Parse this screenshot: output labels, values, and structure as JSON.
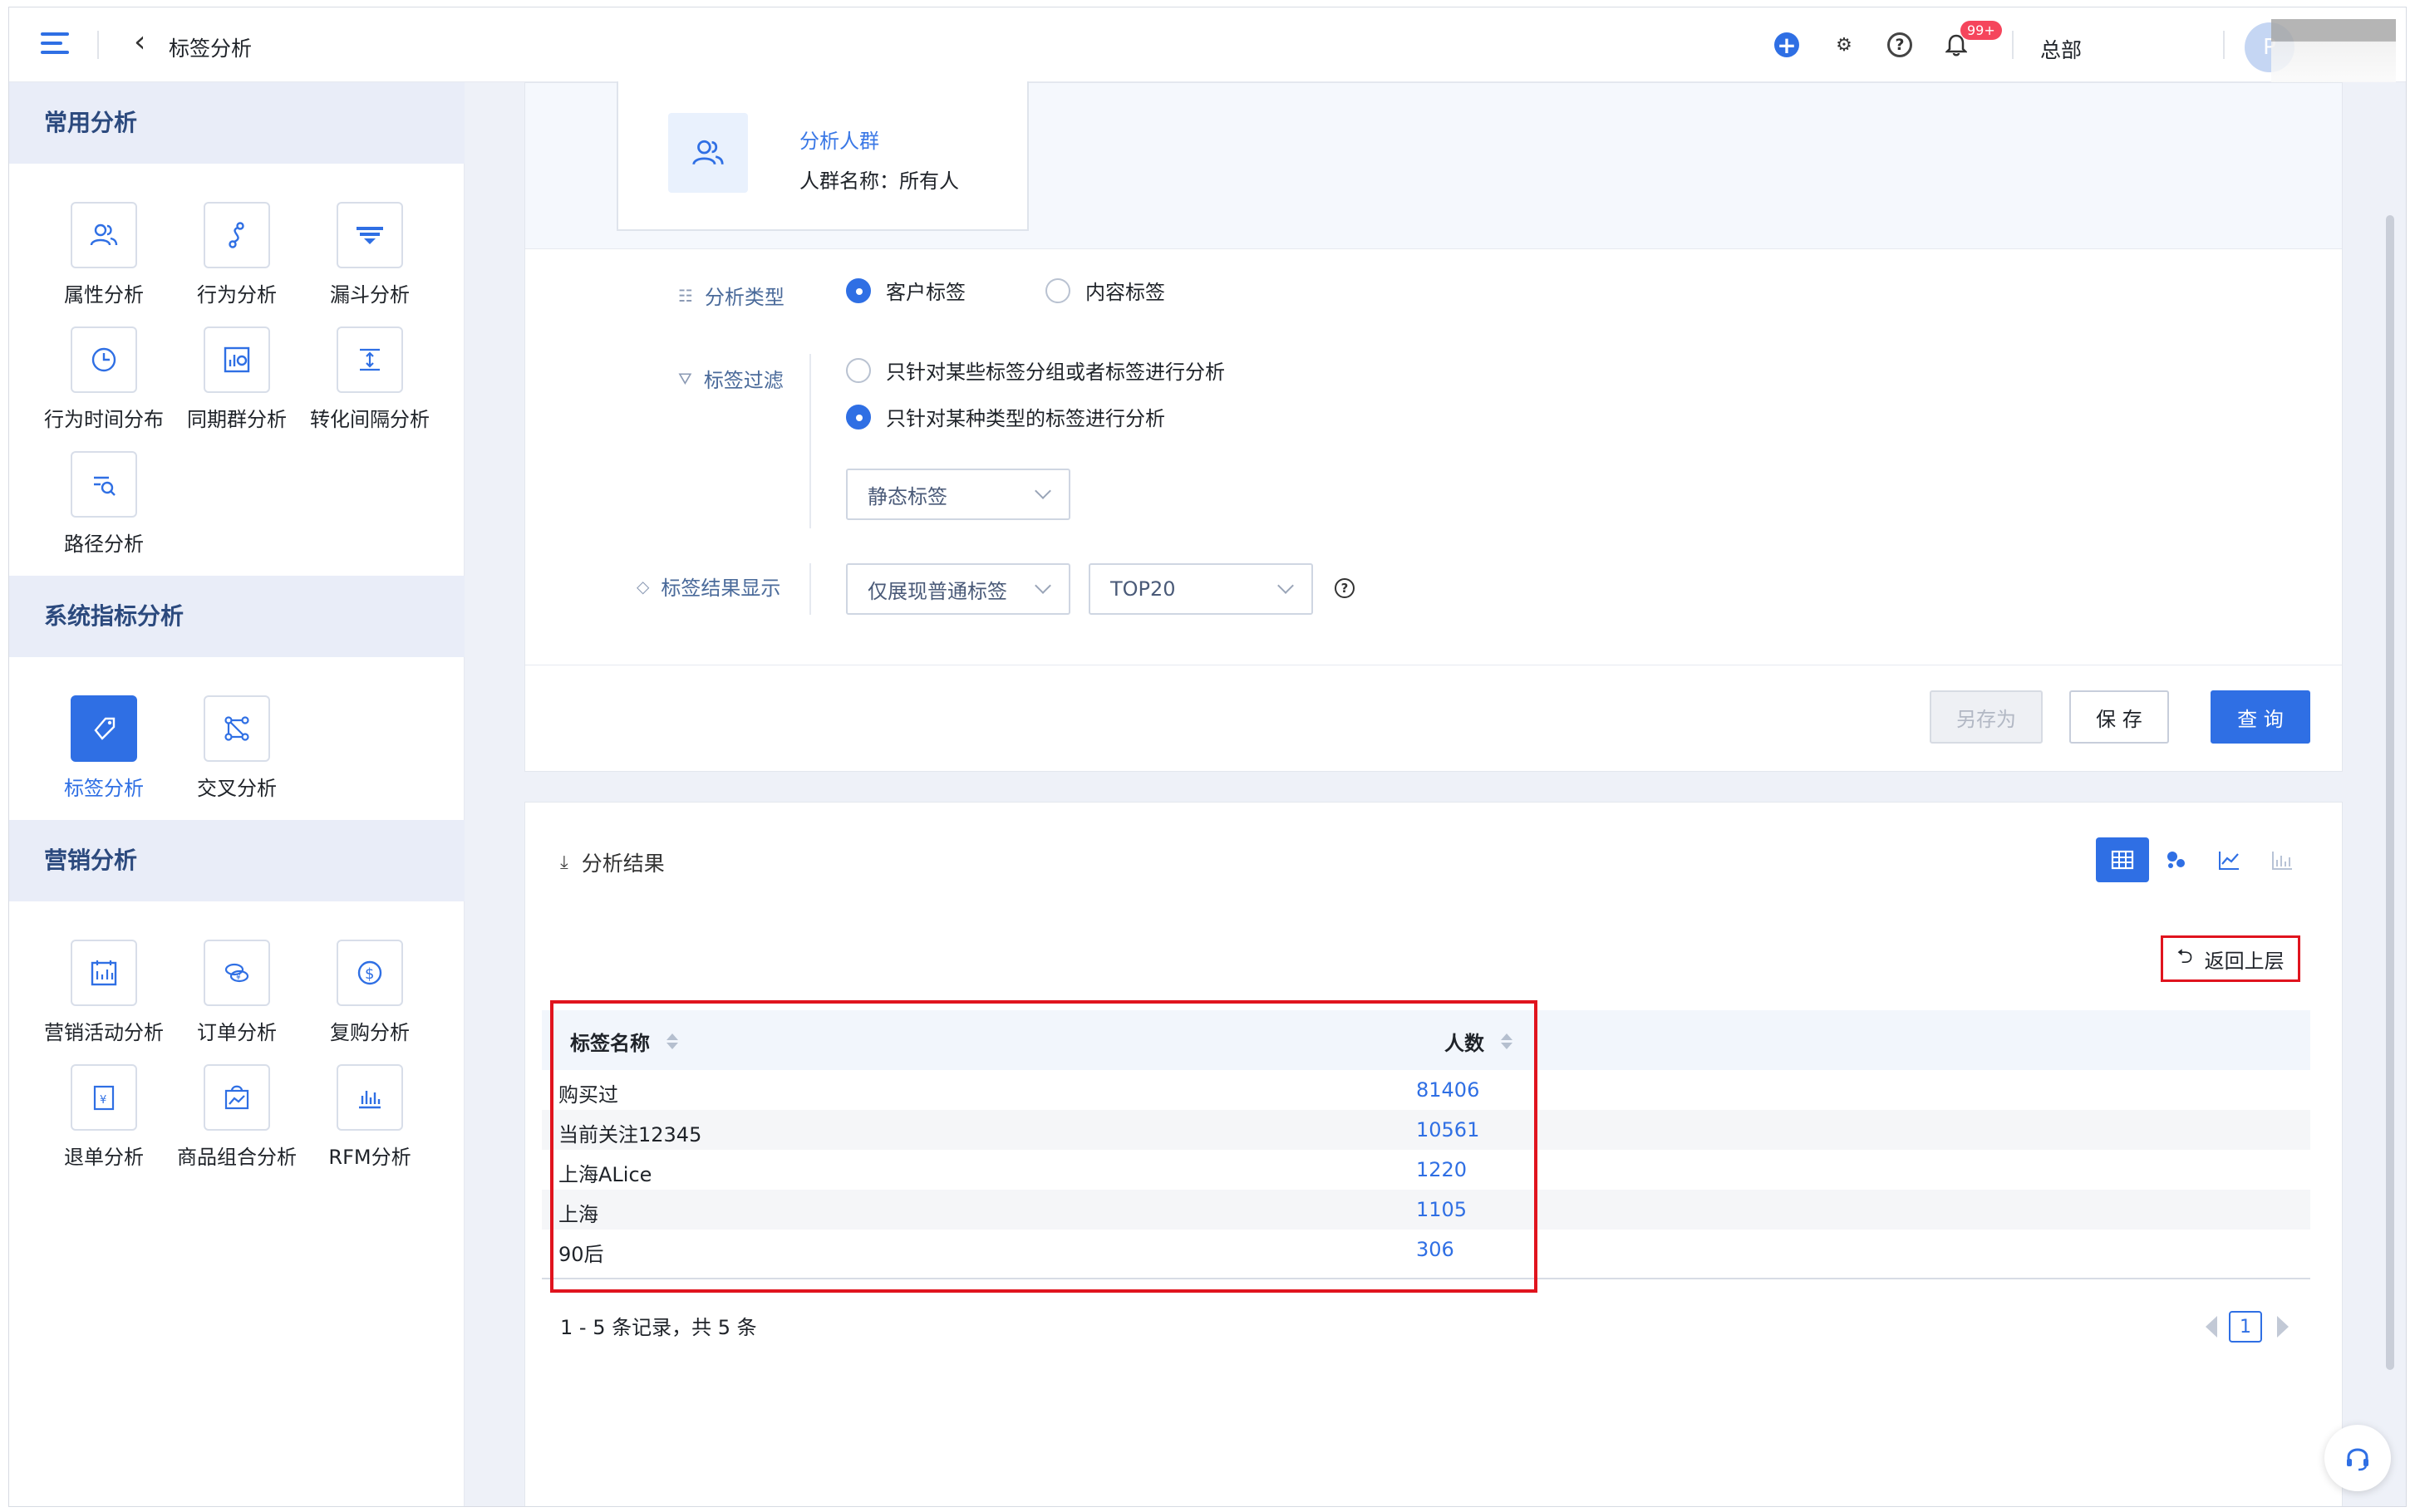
{
  "header": {
    "title": "标签分析",
    "org": "总部",
    "notification_badge": "99+",
    "avatar_initial": "P"
  },
  "sidebar": {
    "sections": [
      {
        "title": "常用分析",
        "items": [
          {
            "label": "属性分析",
            "icon": "users-icon"
          },
          {
            "label": "行为分析",
            "icon": "path-icon"
          },
          {
            "label": "漏斗分析",
            "icon": "funnel-icon"
          },
          {
            "label": "行为时间分布",
            "icon": "clock-icon"
          },
          {
            "label": "同期群分析",
            "icon": "cohort-icon"
          },
          {
            "label": "转化间隔分析",
            "icon": "interval-icon"
          },
          {
            "label": "路径分析",
            "icon": "route-icon"
          }
        ]
      },
      {
        "title": "系统指标分析",
        "items": [
          {
            "label": "标签分析",
            "icon": "tag-icon",
            "active": true
          },
          {
            "label": "交叉分析",
            "icon": "cross-icon"
          }
        ]
      },
      {
        "title": "营销分析",
        "items": [
          {
            "label": "营销活动分析",
            "icon": "calendar-icon"
          },
          {
            "label": "订单分析",
            "icon": "coins-icon"
          },
          {
            "label": "复购分析",
            "icon": "dollar-icon"
          },
          {
            "label": "退单分析",
            "icon": "refund-icon"
          },
          {
            "label": "商品组合分析",
            "icon": "bag-icon"
          },
          {
            "label": "RFM分析",
            "icon": "bar-icon"
          }
        ]
      }
    ]
  },
  "crowd": {
    "title": "分析人群",
    "name_line": "人群名称：所有人"
  },
  "config": {
    "analysis_type_label": "分析类型",
    "analysis_type_options": [
      "客户标签",
      "内容标签"
    ],
    "analysis_type_selected": "客户标签",
    "tag_filter_label": "标签过滤",
    "tag_filter_options": [
      "只针对某些标签分组或者标签进行分析",
      "只针对某种类型的标签进行分析"
    ],
    "tag_type_select": "静态标签",
    "result_display_label": "标签结果显示",
    "display_select": "仅展现普通标签",
    "top_select": "TOP20"
  },
  "buttons": {
    "save_as": "另存为",
    "save": "保 存",
    "query": "查 询"
  },
  "results": {
    "title": "分析结果",
    "back_label": "返回上层",
    "columns": [
      "标签名称",
      "人数"
    ],
    "rows": [
      {
        "name": "购买过",
        "count": "81406"
      },
      {
        "name": "当前关注12345",
        "count": "10561"
      },
      {
        "name": "上海ALice",
        "count": "1220"
      },
      {
        "name": "上海",
        "count": "1105"
      },
      {
        "name": "90后",
        "count": "306"
      }
    ],
    "page_info": "1 - 5 条记录，共 5 条",
    "current_page": "1"
  },
  "colors": {
    "accent": "#2f6fe4",
    "highlight_border": "#e0141e",
    "section_header_bg": "#e9edf8"
  }
}
